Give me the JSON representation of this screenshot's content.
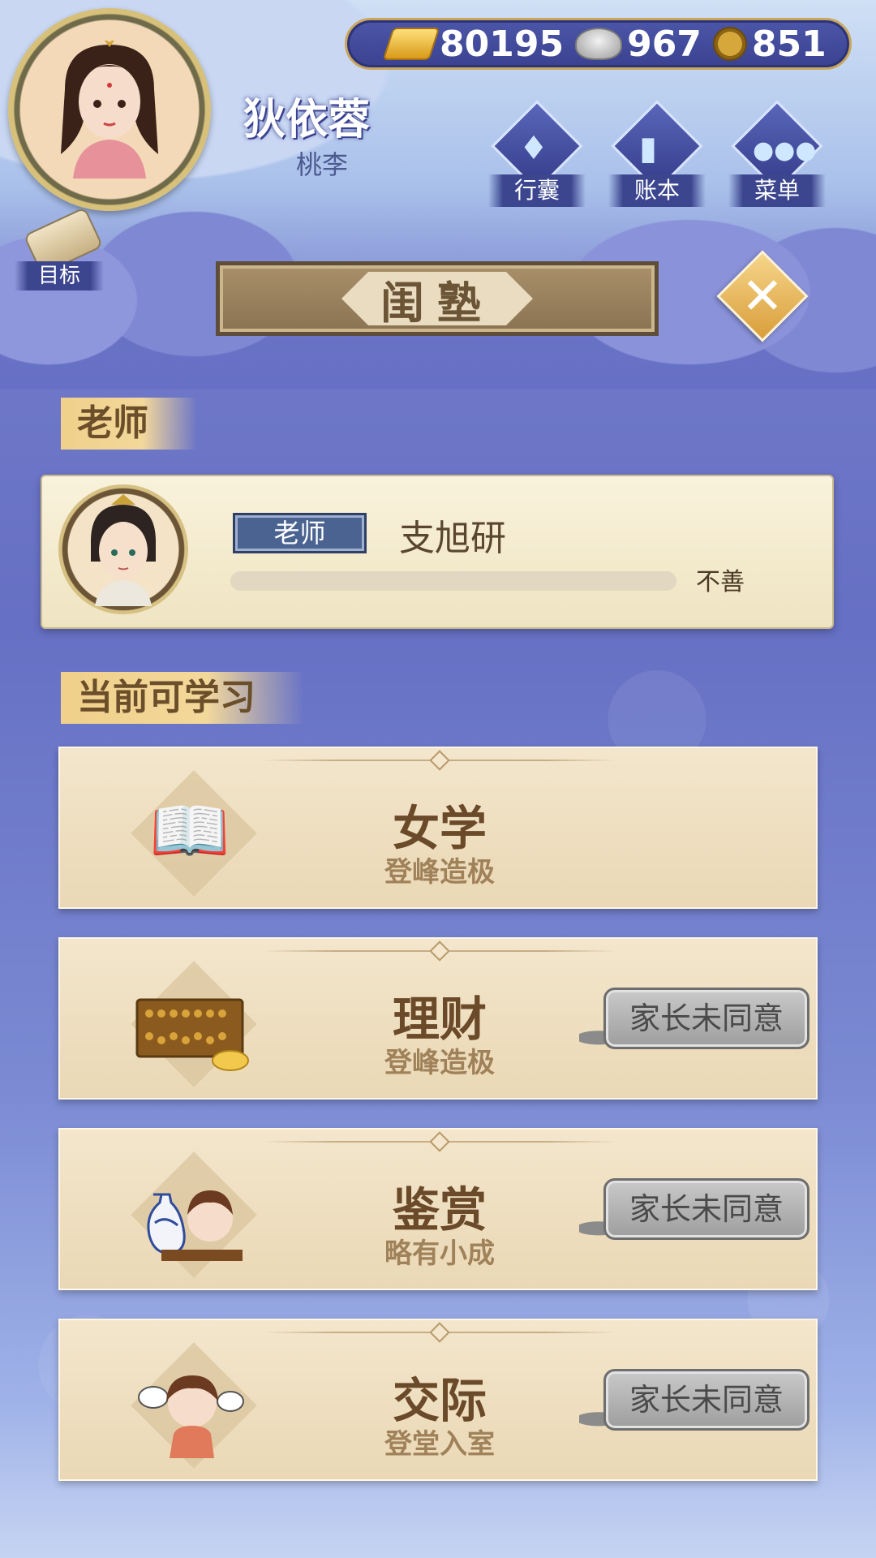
{
  "currency": {
    "gold": "80195",
    "silver": "967",
    "coins": "851"
  },
  "player": {
    "name": "狄依蓉",
    "subtitle": "桃李"
  },
  "top_buttons": [
    {
      "label": "行囊",
      "icon": "bag-icon"
    },
    {
      "label": "账本",
      "icon": "ledger-icon"
    },
    {
      "label": "菜单",
      "icon": "menu-icon"
    }
  ],
  "goal": {
    "label": "目标"
  },
  "title": "闺塾",
  "sections": {
    "teacher": "老师",
    "courses": "当前可学习"
  },
  "teacher": {
    "tag": "老师",
    "name": "支旭研",
    "relation": "不善"
  },
  "courses": [
    {
      "title": "女学",
      "level": "登峰造极",
      "button": ""
    },
    {
      "title": "理财",
      "level": "登峰造极",
      "button": "家长未同意"
    },
    {
      "title": "鉴赏",
      "level": "略有小成",
      "button": "家长未同意"
    },
    {
      "title": "交际",
      "level": "登堂入室",
      "button": "家长未同意"
    }
  ]
}
